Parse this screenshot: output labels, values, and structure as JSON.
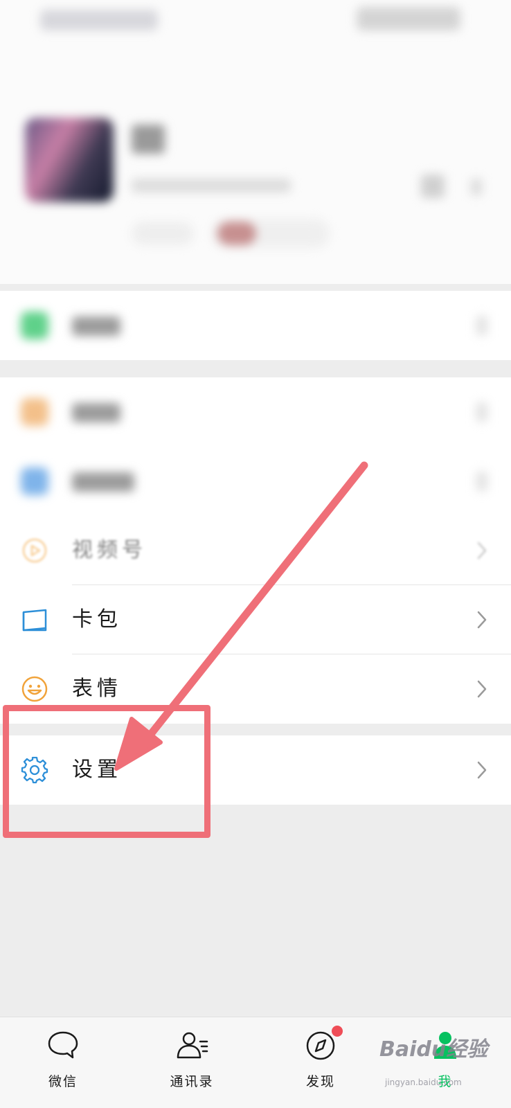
{
  "menu": {
    "video_label": "视频号",
    "cards_label": "卡包",
    "stickers_label": "表情",
    "settings_label": "设置"
  },
  "tabbar": {
    "chats_label": "微信",
    "contacts_label": "通讯录",
    "discover_label": "发现",
    "me_label": "我"
  },
  "watermark": {
    "text": "Baidu经验",
    "url": "jingyan.baidu.com"
  },
  "colors": {
    "accent_green": "#07c160",
    "annotation_red": "#ef6f78",
    "icon_blue": "#2d8fd8",
    "sticker_orange": "#f1a33b",
    "badge_red": "#ef4d57"
  },
  "icons": [
    "pay-icon",
    "favorites-icon",
    "moments-icon",
    "video-channel-icon",
    "card-wallet-icon",
    "sticker-icon",
    "settings-gear-icon",
    "chat-bubble-icon",
    "contacts-icon",
    "compass-icon",
    "me-person-icon",
    "chevron-right-icon"
  ]
}
